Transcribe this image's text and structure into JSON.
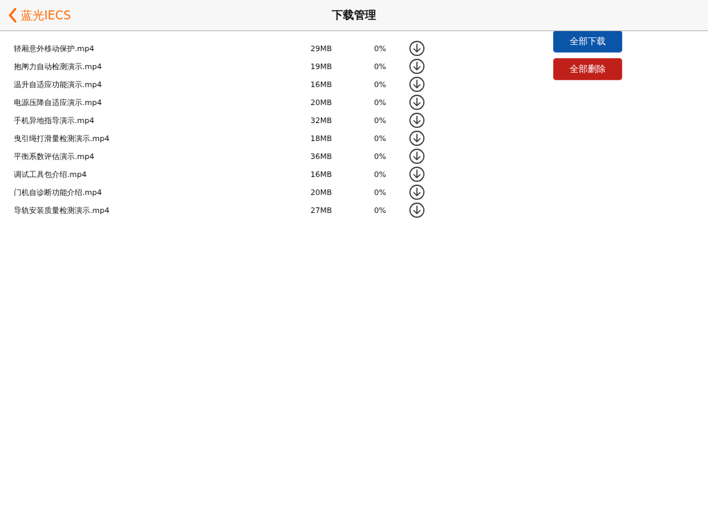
{
  "navigation_bar": {
    "back_button": {
      "label": "蓝光IECS"
    },
    "title": "下载管理"
  },
  "downloads": [
    {
      "name": "轿厢意外移动保护.mp4",
      "size": "29MB",
      "progress": "0%"
    },
    {
      "name": "抱闸力自动检测演示.mp4",
      "size": "19MB",
      "progress": "0%"
    },
    {
      "name": "温升自适应功能演示.mp4",
      "size": "16MB",
      "progress": "0%"
    },
    {
      "name": "电源压降自适应演示.mp4",
      "size": "20MB",
      "progress": "0%"
    },
    {
      "name": "手机异地指导演示.mp4",
      "size": "32MB",
      "progress": "0%"
    },
    {
      "name": "曳引绳打滑量检测演示.mp4",
      "size": "18MB",
      "progress": "0%"
    },
    {
      "name": "平衡系数评估演示.mp4",
      "size": "36MB",
      "progress": "0%"
    },
    {
      "name": "调试工具包介绍.mp4",
      "size": "16MB",
      "progress": "0%"
    },
    {
      "name": "门机自诊断功能介绍.mp4",
      "size": "20MB",
      "progress": "0%"
    },
    {
      "name": "导轨安装质量检测演示.mp4",
      "size": "27MB",
      "progress": "0%"
    }
  ],
  "actions": [
    {
      "label": "全部下载",
      "kind": "download_all"
    },
    {
      "label": "全部删除",
      "kind": "delete_all"
    }
  ]
}
